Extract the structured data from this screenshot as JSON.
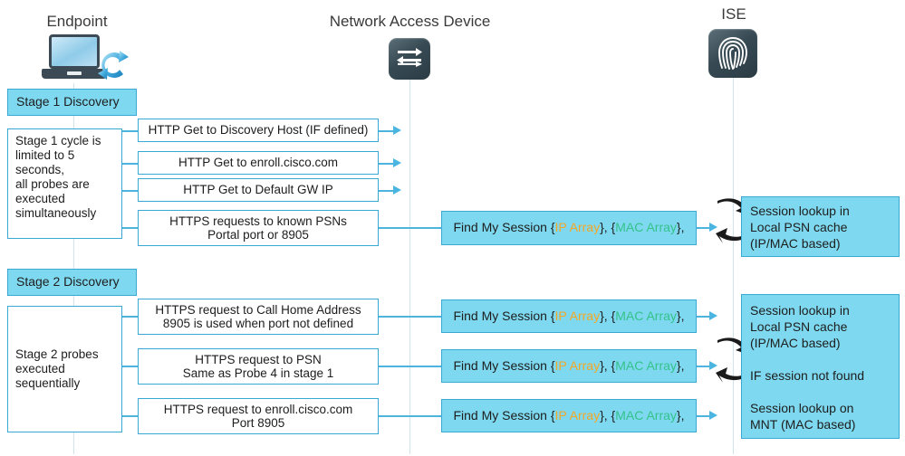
{
  "columns": {
    "endpoint": {
      "title": "Endpoint",
      "icon": "laptop-sync-icon"
    },
    "nad": {
      "title": "Network Access Device",
      "icon": "switch-icon"
    },
    "ise": {
      "title": "ISE",
      "icon": "fingerprint-icon"
    }
  },
  "colors": {
    "cyan_fill": "#7ed9f0",
    "box_border": "#3aa8d4",
    "connector": "#4cb4dd",
    "ip_array": "#f5a623",
    "mac_array": "#34c28a",
    "dark_icon": "#2b3b44"
  },
  "stage1": {
    "header": "Stage 1 Discovery",
    "note": "Stage 1 cycle is limited to 5 seconds,\nall probes are executed simultaneously",
    "note_lines": [
      "Stage 1 cycle is",
      "limited to 5",
      "seconds,",
      "all probes are",
      "executed",
      "simultaneously"
    ],
    "probes": [
      {
        "lines": [
          "HTTP Get to Discovery Host (IF defined)"
        ]
      },
      {
        "lines": [
          "HTTP Get to enroll.cisco.com"
        ]
      },
      {
        "lines": [
          "HTTP Get to Default GW IP"
        ]
      },
      {
        "lines": [
          "HTTPS requests to known PSNs",
          "Portal port or 8905"
        ]
      }
    ],
    "session_msg": {
      "prefix": "Find My Session {",
      "ip": "IP Array",
      "middle": "}, {",
      "mac": "MAC Array",
      "suffix": "},"
    },
    "ise_box_lines": [
      "Session lookup in",
      "Local PSN cache",
      "(IP/MAC based)"
    ]
  },
  "stage2": {
    "header": "Stage 2 Discovery",
    "note_lines": [
      "Stage 2 probes",
      "executed",
      "sequentially"
    ],
    "probes": [
      {
        "lines": [
          "HTTPS request to Call Home Address",
          "8905 is used when port not defined"
        ]
      },
      {
        "lines": [
          "HTTPS request to PSN",
          "Same as Probe 4 in stage 1"
        ]
      },
      {
        "lines": [
          "HTTPS request to enroll.cisco.com",
          "Port 8905"
        ]
      }
    ],
    "session_msg": {
      "prefix": "Find My Session {",
      "ip": "IP Array",
      "middle": "}, {",
      "mac": "MAC Array",
      "suffix": "},"
    },
    "ise_box_lines": [
      "Session lookup in",
      "Local PSN cache",
      "(IP/MAC based)",
      "",
      "IF session not found",
      "",
      "Session lookup on",
      "MNT (MAC based)"
    ]
  }
}
